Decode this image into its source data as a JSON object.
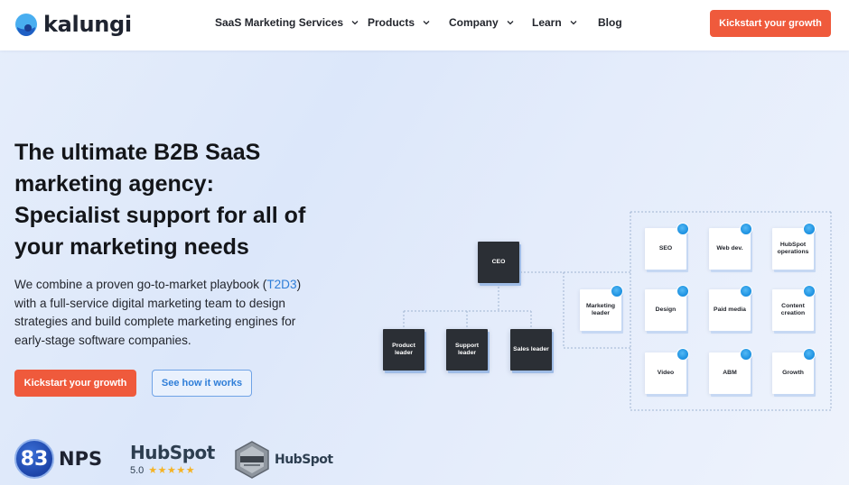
{
  "brand": {
    "name": "kalungi",
    "accent": "#ef5a3c",
    "link": "#2f7ed8"
  },
  "nav": {
    "items": [
      {
        "label": "SaaS Marketing Services",
        "has_dropdown": true
      },
      {
        "label": "Products",
        "has_dropdown": true
      },
      {
        "label": "Company",
        "has_dropdown": true
      },
      {
        "label": "Learn",
        "has_dropdown": true
      },
      {
        "label": "Blog",
        "has_dropdown": false
      }
    ],
    "cta_label": "Kickstart your growth"
  },
  "hero": {
    "headline_lines": [
      "The ultimate B2B SaaS",
      "marketing agency:",
      "Specialist support for all of",
      "your marketing needs"
    ],
    "sub_line1_pre": "We combine a proven go-to-market playbook (",
    "sub_link": "T2D3",
    "sub_line1_post": ")",
    "sub_lines": [
      "with a full-service digital marketing team to design",
      "strategies and build complete marketing engines for",
      "early-stage software companies."
    ],
    "primary_button": "Kickstart your growth",
    "secondary_button": "See how it works"
  },
  "badges": {
    "nps_score": "83",
    "nps_label": "NPS",
    "hubspot_word": "HubSpot",
    "hubspot_rating": "5.0",
    "hubspot_stars": "★★★★★",
    "platinum_word": "HubSpot"
  },
  "org_chart": {
    "ceo": "CEO",
    "leaders": [
      "Product leader",
      "Support leader",
      "Sales leader"
    ],
    "marketing_leader": "Marketing leader",
    "team": [
      [
        "SEO",
        "Web dev.",
        "HubSpot operations"
      ],
      [
        "Design",
        "Paid media",
        "Content creation"
      ],
      [
        "Video",
        "ABM",
        "Growth"
      ]
    ]
  }
}
